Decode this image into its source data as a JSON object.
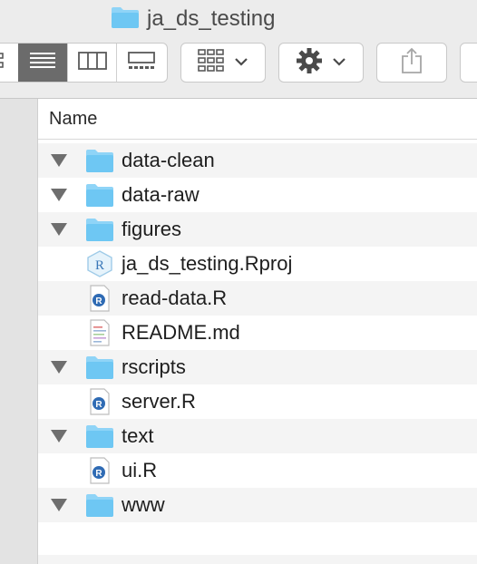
{
  "window": {
    "title": "ja_ds_testing",
    "title_icon": "folder-icon"
  },
  "toolbar": {
    "view_buttons": [
      {
        "name": "icon-view",
        "icon": "icon-grid-icon",
        "active": false
      },
      {
        "name": "list-view",
        "icon": "list-icon",
        "active": true
      },
      {
        "name": "column-view",
        "icon": "columns-icon",
        "active": false
      },
      {
        "name": "gallery-view",
        "icon": "gallery-icon",
        "active": false
      }
    ],
    "group_icon": "group-grid-icon",
    "action_icon": "gear-icon",
    "share_icon": "share-icon"
  },
  "list": {
    "header": "Name",
    "items": [
      {
        "label": "data-clean",
        "kind": "folder",
        "expandable": true
      },
      {
        "label": "data-raw",
        "kind": "folder",
        "expandable": true
      },
      {
        "label": "figures",
        "kind": "folder",
        "expandable": true
      },
      {
        "label": "ja_ds_testing.Rproj",
        "kind": "rproj",
        "expandable": false
      },
      {
        "label": "read-data.R",
        "kind": "r-file",
        "expandable": false
      },
      {
        "label": "README.md",
        "kind": "text-file",
        "expandable": false
      },
      {
        "label": "rscripts",
        "kind": "folder",
        "expandable": true
      },
      {
        "label": "server.R",
        "kind": "r-file",
        "expandable": false
      },
      {
        "label": "text",
        "kind": "folder",
        "expandable": true
      },
      {
        "label": "ui.R",
        "kind": "r-file",
        "expandable": false
      },
      {
        "label": "www",
        "kind": "folder",
        "expandable": true
      }
    ]
  },
  "colors": {
    "folder": "#6ec7f3",
    "folder_tab": "#8fd4f7",
    "r_badge": "#2f6bb4",
    "chrome": "#ececec",
    "selected_view": "#6b6b6b"
  }
}
